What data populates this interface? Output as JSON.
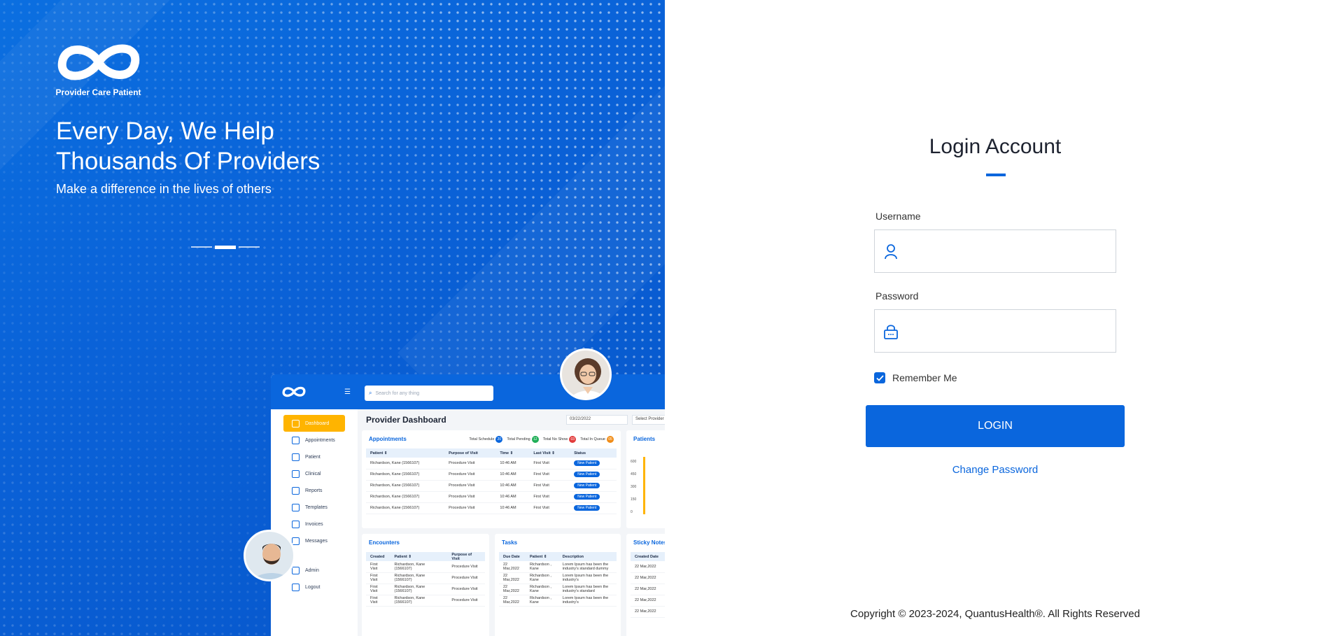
{
  "brand": {
    "logo_text": "Provider Care Patient"
  },
  "hero": {
    "headline_line1": "Every Day, We Help",
    "headline_line2": "Thousands Of Providers",
    "subline": "Make a difference in the lives of others",
    "carousel": {
      "slides": 3,
      "active_index": 1
    }
  },
  "dashboard_preview": {
    "search_placeholder": "Search for any thing",
    "title": "Provider Dashboard",
    "date": "03/22/2022",
    "provider_select": "Select Provider",
    "menu": [
      {
        "label": "Dashboard",
        "active": true
      },
      {
        "label": "Appointments"
      },
      {
        "label": "Patient"
      },
      {
        "label": "Clinical"
      },
      {
        "label": "Reports"
      },
      {
        "label": "Templates"
      },
      {
        "label": "Invoices"
      },
      {
        "label": "Messages"
      },
      {
        "label": "Admin"
      },
      {
        "label": "Logout"
      }
    ],
    "appointments": {
      "title": "Appointments",
      "stats": [
        {
          "label": "Total Schedule",
          "value": "20",
          "color": "#0a66dd"
        },
        {
          "label": "Total Pending",
          "value": "12",
          "color": "#1fae57"
        },
        {
          "label": "Total No Show",
          "value": "03",
          "color": "#e23b3b"
        },
        {
          "label": "Total In Queue",
          "value": "05",
          "color": "#f08c17"
        }
      ],
      "columns": [
        "Patient ⇕",
        "Purpose of Visit",
        "Time ⇕",
        "Last Visit ⇕",
        "Status"
      ],
      "rows": [
        [
          "Richardson, Kane (1566107)",
          "Procedure Visit",
          "10:46 AM",
          "First Visit",
          "New Patient"
        ],
        [
          "Richardson, Kane (1566107)",
          "Procedure Visit",
          "10:46 AM",
          "First Visit",
          "New Patient"
        ],
        [
          "Richardson, Kane (1566107)",
          "Procedure Visit",
          "10:46 AM",
          "First Visit",
          "New Patient"
        ],
        [
          "Richardson, Kane (1566107)",
          "Procedure Visit",
          "10:46 AM",
          "First Visit",
          "New Patient"
        ],
        [
          "Richardson, Kane (1566107)",
          "Procedure Visit",
          "10:46 AM",
          "First Visit",
          "New Patient"
        ]
      ]
    },
    "patients_card": {
      "title": "Patients",
      "ticks": [
        "600",
        "450",
        "300",
        "150",
        "0"
      ]
    },
    "encounters": {
      "title": "Encounters",
      "columns": [
        "Created",
        "Patient ⇕",
        "Purpose of Visit"
      ],
      "rows": [
        [
          "First Visit",
          "Richardson, Kane (1566107)",
          "Procedure Visit"
        ],
        [
          "First Visit",
          "Richardson, Kane (1566107)",
          "Procedure Visit"
        ],
        [
          "First Visit",
          "Richardson, Kane (1566107)",
          "Procedure Visit"
        ],
        [
          "First Visit",
          "Richardson, Kane (1566107)",
          "Procedure Visit"
        ]
      ]
    },
    "tasks": {
      "title": "Tasks",
      "columns": [
        "Due Date",
        "Patient ⇕",
        "Description"
      ],
      "rows": [
        [
          "22 Mar,2022",
          "Richardson , Kane",
          "Lorem Ipsum has been the industry's standard dummy"
        ],
        [
          "22 Mar,2022",
          "Richardson , Kane",
          "Lorem Ipsum has been the industry's"
        ],
        [
          "22 Mar,2022",
          "Richardson , Kane",
          "Lorem Ipsum has been the industry's standard"
        ],
        [
          "22 Mar,2022",
          "Richardson , Kane",
          "Lorem Ipsum has been the industry's"
        ]
      ]
    },
    "sticky": {
      "title": "Sticky Notes",
      "column": "Created Date",
      "rows": [
        "22 Mar,2022",
        "22 Mar,2022",
        "22 Mar,2022",
        "22 Mar,2022",
        "22 Mar,2022"
      ]
    }
  },
  "login": {
    "title": "Login Account",
    "username_label": "Username",
    "username_value": "",
    "password_label": "Password",
    "password_value": "",
    "remember_label": "Remember Me",
    "remember_checked": true,
    "login_button": "LOGIN",
    "change_password": "Change Password"
  },
  "footer": {
    "copyright": "Copyright © 2023-2024, QuantusHealth®. All Rights Reserved"
  },
  "colors": {
    "primary": "#0a66dd",
    "accent": "#ffb400",
    "text": "#1e2330"
  }
}
